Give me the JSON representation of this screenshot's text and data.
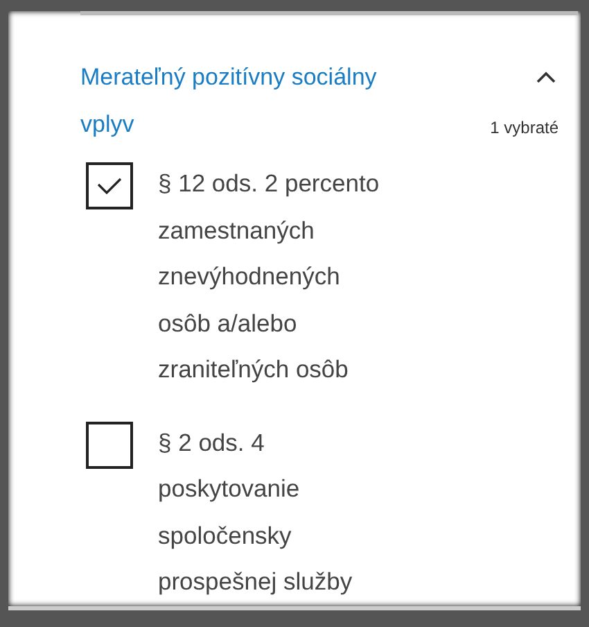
{
  "filter_group": {
    "title": "Merateľný pozitívny sociálny vplyv",
    "expanded": true,
    "selection_count": "1 vybraté",
    "options": [
      {
        "label": "§ 12 ods. 2 percento zamestnaných znevýhodnených osôb a/alebo zraniteľných osôb",
        "checked": true
      },
      {
        "label": "§ 2 ods. 4 poskytovanie spoločensky prospešnej služby",
        "checked": false
      }
    ]
  }
}
